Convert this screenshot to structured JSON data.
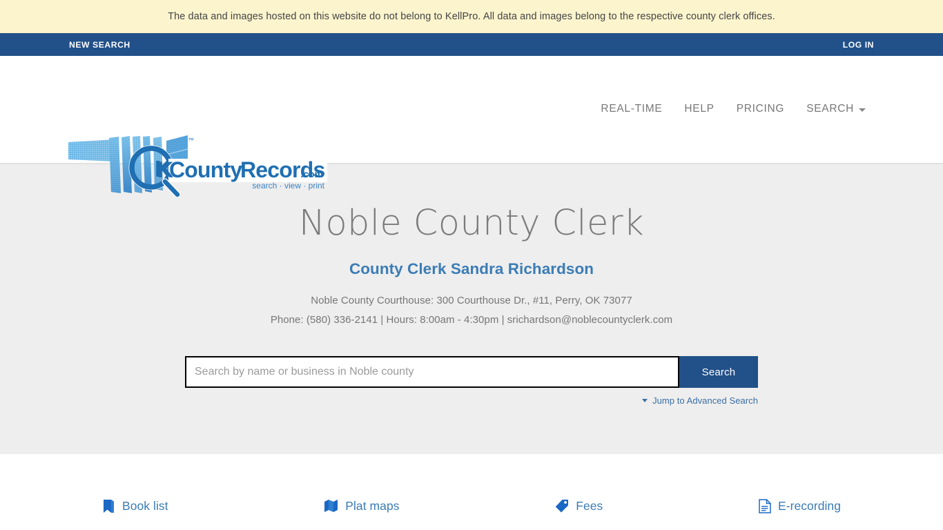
{
  "disclaimer": {
    "text": "The data and images hosted on this website do not belong to KellPro. All data and images belong to the respective county clerk offices."
  },
  "utility_nav": {
    "new_search": "NEW SEARCH",
    "log_in": "LOG IN"
  },
  "logo": {
    "brand_ok": "OK",
    "brand_county": "County",
    "brand_records": "Records",
    "brand_dotcom": ".com",
    "tagline": "search · view · print",
    "trademark": "™",
    "alt": "OKCountyRecords.com - search, view, print"
  },
  "main_nav": {
    "items": [
      {
        "label": "REAL-TIME",
        "icon": "",
        "has_caret": false
      },
      {
        "label": "HELP",
        "icon": "",
        "has_caret": false
      },
      {
        "label": "PRICING",
        "icon": "",
        "has_caret": false
      },
      {
        "label": "SEARCH",
        "icon": "chevron-down-icon",
        "has_caret": true
      }
    ]
  },
  "hero": {
    "county_title": "Noble County Clerk",
    "clerk_name": "County Clerk Sandra Richardson",
    "address": "Noble County Courthouse: 300 Courthouse Dr., #11, Perry, OK 73077",
    "contact": "Phone: (580) 336-2141 | Hours: 8:00am - 4:30pm | srichardson@noblecountyclerk.com"
  },
  "search": {
    "placeholder": "Search by name or business in Noble county",
    "value": "",
    "button_label": "Search",
    "advanced_label": "Jump to Advanced Search"
  },
  "quicklinks": [
    {
      "label": "Book list",
      "icon": "book-icon"
    },
    {
      "label": "Plat maps",
      "icon": "map-icon"
    },
    {
      "label": "Fees",
      "icon": "tag-icon"
    },
    {
      "label": "E-recording",
      "icon": "document-icon"
    }
  ],
  "colors": {
    "banner_yellow": "#fcf4cd",
    "nav_blue": "#225089",
    "link_blue": "#3b7cb5",
    "hero_gray": "#eeeeee",
    "title_gray": "#7b7b7b"
  }
}
